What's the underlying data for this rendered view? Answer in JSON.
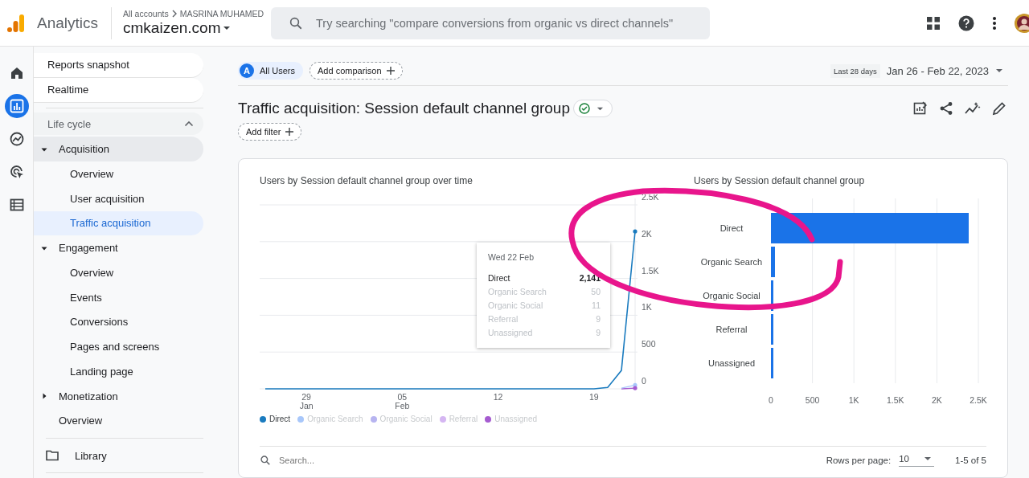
{
  "header": {
    "product": "Analytics",
    "breadcrumb": "All accounts",
    "account": "MASRINA MUHAMED",
    "property": "cmkaizen.com",
    "search_placeholder": "Try searching \"compare conversions from organic vs direct channels\""
  },
  "rail": [
    {
      "kind": "home",
      "selected": false
    },
    {
      "kind": "reports",
      "selected": true
    },
    {
      "kind": "explore",
      "selected": false
    },
    {
      "kind": "advertising",
      "selected": false
    },
    {
      "kind": "configure",
      "selected": false
    }
  ],
  "nav": {
    "items": [
      {
        "label": "Reports snapshot"
      },
      {
        "label": "Realtime"
      }
    ],
    "section": {
      "label": "Life cycle",
      "expanded": true,
      "children": [
        {
          "label": "Acquisition",
          "kind": "group",
          "expanded": true,
          "active": true,
          "children": [
            {
              "label": "Overview",
              "selected": false
            },
            {
              "label": "User acquisition",
              "selected": false
            },
            {
              "label": "Traffic acquisition",
              "selected": true
            }
          ]
        },
        {
          "label": "Engagement",
          "kind": "group",
          "expanded": true,
          "active": false,
          "children": [
            {
              "label": "Overview",
              "selected": false
            },
            {
              "label": "Events",
              "selected": false
            },
            {
              "label": "Conversions",
              "selected": false
            },
            {
              "label": "Pages and screens",
              "selected": false
            },
            {
              "label": "Landing page",
              "selected": false
            }
          ]
        },
        {
          "label": "Monetization",
          "kind": "group",
          "expanded": false,
          "active": false
        },
        {
          "label": "Overview",
          "kind": "leaf",
          "active": false
        }
      ]
    },
    "library": "Library"
  },
  "comparisons": [
    {
      "letter": "A",
      "label": "All Users"
    }
  ],
  "add_comparison": "Add comparison",
  "date_range": {
    "preset": "Last 28 days",
    "range": "Jan 26 - Feb 22, 2023"
  },
  "report": {
    "title": "Traffic acquisition: Session default channel group",
    "verified": true,
    "add_filter": "Add filter"
  },
  "line_chart": {
    "chart_data": {
      "type": "line",
      "title": "Users by Session default channel group over time",
      "grid": true,
      "categories": [
        null,
        null,
        null,
        "29 Jan",
        null,
        null,
        null,
        null,
        null,
        null,
        "05 Feb",
        null,
        null,
        null,
        null,
        null,
        null,
        "12",
        null,
        null,
        null,
        null,
        null,
        null,
        "19",
        null,
        null,
        null
      ],
      "ylim": [
        0,
        2500
      ],
      "yticks": [
        {
          "value": 0,
          "label": "0"
        },
        {
          "value": 500,
          "label": "500"
        },
        {
          "value": 1000,
          "label": "1K"
        },
        {
          "value": 1500,
          "label": "1.5K"
        },
        {
          "value": 2000,
          "label": "2K"
        },
        {
          "value": 2500,
          "label": "2.5K"
        }
      ],
      "series": [
        {
          "name": "Direct",
          "color": "#1a7bbf",
          "values": [
            0,
            0,
            0,
            0,
            0,
            0,
            0,
            0,
            0,
            0,
            0,
            0,
            0,
            0,
            0,
            0,
            0,
            0,
            0,
            0,
            0,
            0,
            0,
            0,
            0,
            20,
            250,
            2140
          ]
        },
        {
          "name": "Organic Search",
          "color": "#a8c7fa",
          "values": [
            null,
            null,
            null,
            null,
            null,
            null,
            null,
            null,
            null,
            null,
            null,
            null,
            null,
            null,
            null,
            null,
            null,
            null,
            null,
            null,
            null,
            null,
            null,
            null,
            null,
            null,
            10,
            50
          ]
        },
        {
          "name": "Organic Social",
          "color": "#b7b4f0",
          "values": [
            null,
            null,
            null,
            null,
            null,
            null,
            null,
            null,
            null,
            null,
            null,
            null,
            null,
            null,
            null,
            null,
            null,
            null,
            null,
            null,
            null,
            null,
            null,
            null,
            null,
            null,
            null,
            null
          ]
        },
        {
          "name": "Referral",
          "color": "#d5b6f2",
          "values": [
            null,
            null,
            null,
            null,
            null,
            null,
            null,
            null,
            null,
            null,
            null,
            null,
            null,
            null,
            null,
            null,
            null,
            null,
            null,
            null,
            null,
            null,
            null,
            null,
            null,
            null,
            null,
            null
          ]
        },
        {
          "name": "Unassigned",
          "color": "#a55bd0",
          "values": [
            null,
            null,
            null,
            null,
            null,
            null,
            null,
            null,
            null,
            null,
            null,
            null,
            null,
            null,
            null,
            null,
            null,
            null,
            null,
            null,
            null,
            null,
            null,
            null,
            null,
            null,
            0,
            10
          ]
        }
      ]
    },
    "legend": [
      {
        "selected": true
      },
      {
        "selected": false
      },
      {
        "selected": false
      },
      {
        "selected": false
      },
      {
        "selected": false
      }
    ],
    "tooltip": {
      "date": "Wed 22 Feb",
      "rows": [
        {
          "label": "Direct",
          "value": "2,141",
          "selected": true
        },
        {
          "label": "Organic Search",
          "value": "50",
          "selected": false
        },
        {
          "label": "Organic Social",
          "value": "11",
          "selected": false
        },
        {
          "label": "Referral",
          "value": "9",
          "selected": false
        },
        {
          "label": "Unassigned",
          "value": "9",
          "selected": false
        }
      ]
    }
  },
  "bar_chart": {
    "chart_data": {
      "type": "bar",
      "orientation": "horizontal",
      "title": "Users by Session default channel group",
      "grid": true,
      "categories": [
        "Direct",
        "Organic Search",
        "Organic Social",
        "Referral",
        "Unassigned"
      ],
      "values": [
        2380,
        50,
        30,
        30,
        30
      ],
      "xlim": [
        0,
        2500
      ],
      "xticks": [
        {
          "value": 0,
          "label": "0"
        },
        {
          "value": 500,
          "label": "500"
        },
        {
          "value": 1000,
          "label": "1K"
        },
        {
          "value": 1500,
          "label": "1.5K"
        },
        {
          "value": 2000,
          "label": "2K"
        },
        {
          "value": 2500,
          "label": "2.5K"
        }
      ]
    }
  },
  "table_bar": {
    "search_placeholder": "Search...",
    "rows_per_page_label": "Rows per page:",
    "rows_per_page": "10",
    "pagination": "1-5 of 5"
  },
  "annotation": {
    "kind": "marker-loop",
    "color": "#e8158c"
  }
}
